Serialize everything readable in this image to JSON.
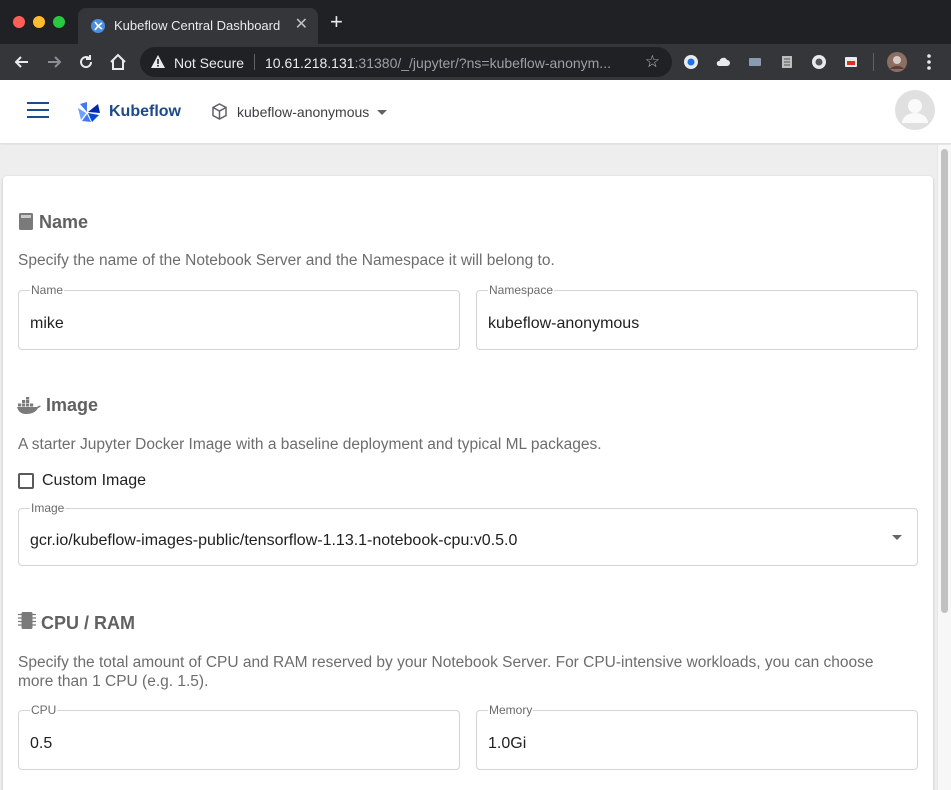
{
  "browser": {
    "tab_title": "Kubeflow Central Dashboard",
    "tab_close": "✕",
    "new_tab": "+",
    "security_label": "Not Secure",
    "url_host": "10.61.218.131",
    "url_rest": ":31380/_/jupyter/?ns=kubeflow-anonym...",
    "bookmark_star": "☆"
  },
  "header": {
    "app_name": "Kubeflow",
    "namespace": "kubeflow-anonymous"
  },
  "form": {
    "name_section": {
      "title": "Name",
      "description": "Specify the name of the Notebook Server and the Namespace it will belong to.",
      "name_label": "Name",
      "name_value": "mike",
      "namespace_label": "Namespace",
      "namespace_value": "kubeflow-anonymous"
    },
    "image_section": {
      "title": "Image",
      "description": "A starter Jupyter Docker Image with a baseline deployment and typical ML packages.",
      "custom_image_label": "Custom Image",
      "custom_image_checked": false,
      "image_label": "Image",
      "image_value": "gcr.io/kubeflow-images-public/tensorflow-1.13.1-notebook-cpu:v0.5.0"
    },
    "cpu_ram_section": {
      "title": "CPU / RAM",
      "description_line1": "Specify the total amount of CPU and RAM reserved by your Notebook Server. For CPU-intensive workloads, you can choose",
      "description_line2": "more than 1 CPU (e.g. 1.5).",
      "cpu_label": "CPU",
      "cpu_value": "0.5",
      "memory_label": "Memory",
      "memory_value": "1.0Gi"
    }
  },
  "colors": {
    "brand": "#1a4a8a",
    "chrome_dark": "#202124",
    "chrome_toolbar": "#35363a"
  },
  "icons": [
    "kubeflow-favicon",
    "warning-icon",
    "back-arrow-icon",
    "forward-arrow-icon",
    "reload-icon",
    "home-icon",
    "star-icon",
    "hamburger-menu-icon",
    "kubeflow-logo",
    "cube-icon",
    "chevron-down-icon",
    "avatar-icon",
    "book-icon",
    "docker-whale-icon",
    "chip-icon"
  ]
}
